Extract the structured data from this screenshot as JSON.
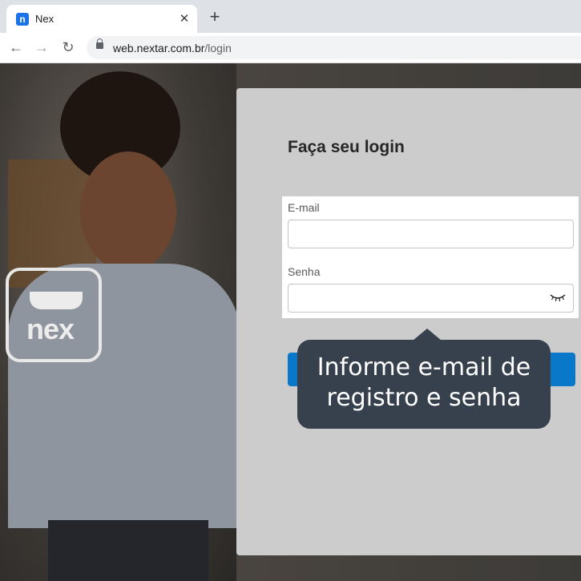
{
  "browser": {
    "tab_title": "Nex",
    "favicon_letter": "n",
    "close_glyph": "✕",
    "new_tab_glyph": "+",
    "back_glyph": "←",
    "forward_glyph": "→",
    "reload_glyph": "↻",
    "url_host": "web.nextar.com.br",
    "url_path": "/login"
  },
  "branding": {
    "logo_text": "nex"
  },
  "login": {
    "title": "Faça seu login",
    "email_label": "E-mail",
    "email_value": "",
    "password_label": "Senha",
    "password_value": ""
  },
  "tooltip": {
    "line1": "Informe e-mail de",
    "line2": "registro e senha"
  },
  "colors": {
    "primary_button": "#0a78c8",
    "tooltip_bg": "#37404d",
    "panel_bg": "#cccccc"
  }
}
